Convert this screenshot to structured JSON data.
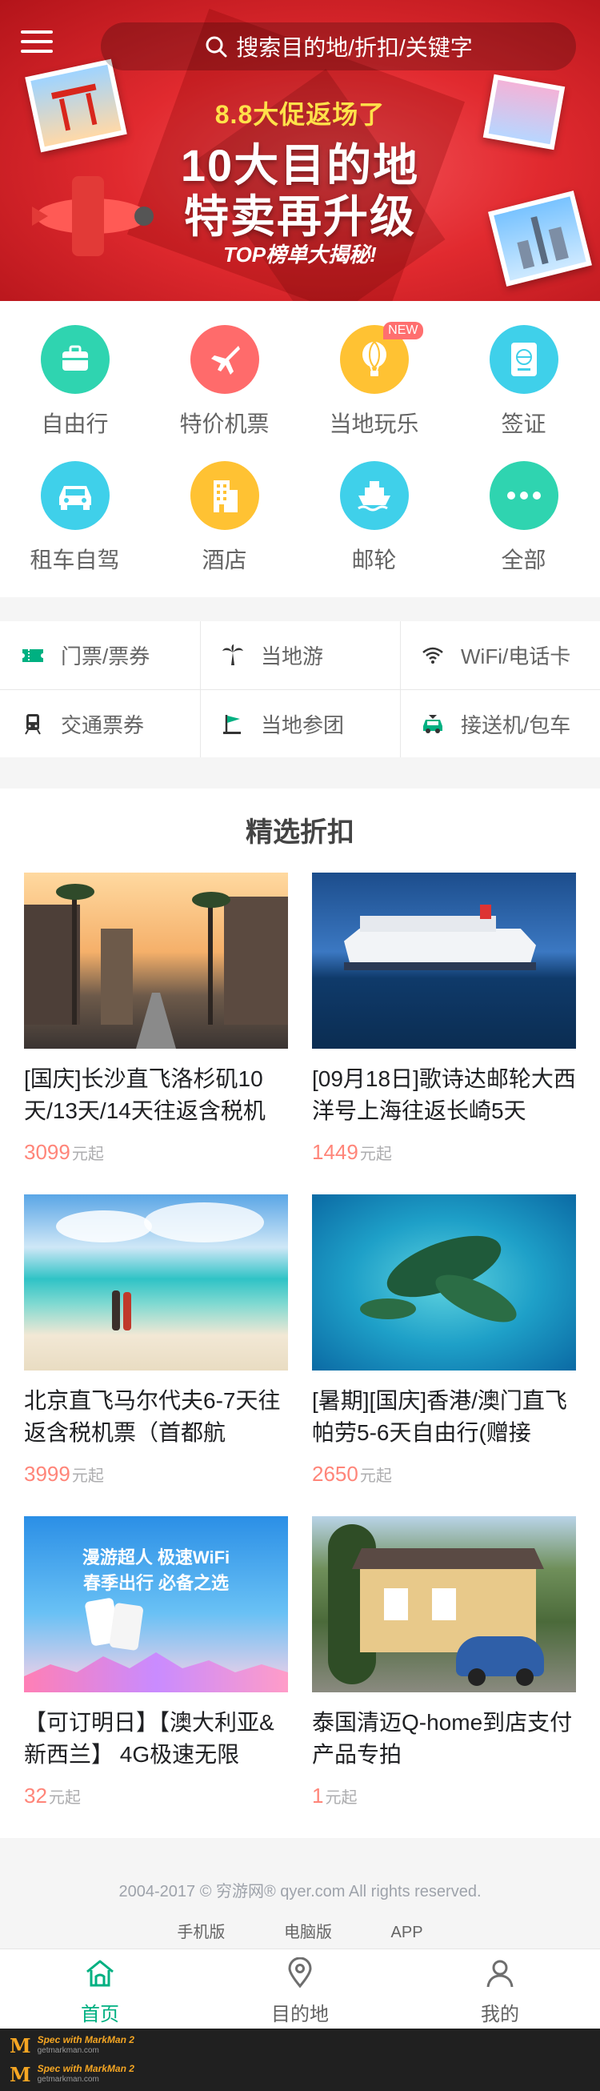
{
  "banner": {
    "search_placeholder": "搜索目的地/折扣/关键字",
    "subtitle": "8.8大促返场了",
    "title_line1": "10大目的地",
    "title_line2": "特卖再升级",
    "tagline": "TOP榜单大揭秘!"
  },
  "categories": [
    {
      "label": "自由行",
      "icon": "suitcase-icon",
      "color": "#2fd4b0"
    },
    {
      "label": "特价机票",
      "icon": "airplane-icon",
      "color": "#ff6b6b"
    },
    {
      "label": "当地玩乐",
      "icon": "balloon-icon",
      "color": "#ffc233",
      "badge": "NEW"
    },
    {
      "label": "签证",
      "icon": "passport-icon",
      "color": "#3fd0ea"
    },
    {
      "label": "租车自驾",
      "icon": "car-icon",
      "color": "#3fd0ea"
    },
    {
      "label": "酒店",
      "icon": "building-icon",
      "color": "#ffc233"
    },
    {
      "label": "邮轮",
      "icon": "ship-icon",
      "color": "#3fd0ea"
    },
    {
      "label": "全部",
      "icon": "more-icon",
      "color": "#2fd4b0"
    }
  ],
  "sub_menu": [
    {
      "label": "门票/票券",
      "icon": "ticket-icon"
    },
    {
      "label": "当地游",
      "icon": "palm-tree-icon"
    },
    {
      "label": "WiFi/电话卡",
      "icon": "wifi-icon"
    },
    {
      "label": "交通票券",
      "icon": "train-icon"
    },
    {
      "label": "当地参团",
      "icon": "flag-icon"
    },
    {
      "label": "接送机/包车",
      "icon": "shuttle-car-icon"
    }
  ],
  "deals_title": "精选折扣",
  "deals": [
    {
      "title": "[国庆]长沙直飞洛杉矶10天/13天/14天往返含税机",
      "price": "3099",
      "unit": "元起",
      "scene": "city-street"
    },
    {
      "title": "[09月18日]歌诗达邮轮大西洋号上海往返长崎5天",
      "price": "1449",
      "unit": "元起",
      "scene": "cruise"
    },
    {
      "title": "北京直飞马尔代夫6-7天往返含税机票（首都航",
      "price": "3999",
      "unit": "元起",
      "scene": "beach"
    },
    {
      "title": "[暑期][国庆]香港/澳门直飞帕劳5-6天自由行(赠接",
      "price": "2650",
      "unit": "元起",
      "scene": "islands"
    },
    {
      "title": "【可订明日】【澳大利亚&新西兰】 4G极速无限",
      "price": "32",
      "unit": "元起",
      "scene": "wifi-ad",
      "ad_line1": "漫游超人 极速WiFi",
      "ad_line2": "春季出行 必备之选"
    },
    {
      "title": "泰国清迈Q-home到店支付产品专拍",
      "price": "1",
      "unit": "元起",
      "scene": "house"
    }
  ],
  "footer": {
    "copyright": "2004-2017 © 穷游网® qyer.com All rights reserved.",
    "links": [
      "手机版",
      "电脑版",
      "APP"
    ]
  },
  "tabs": [
    {
      "label": "首页",
      "icon": "home-icon",
      "active": true
    },
    {
      "label": "目的地",
      "icon": "location-pin-icon",
      "active": false
    },
    {
      "label": "我的",
      "icon": "user-icon",
      "active": false
    }
  ],
  "watermark": {
    "brand": "Spec with MarkMan 2",
    "site": "getmarkman.com"
  },
  "colors": {
    "primary_text": "#1f2023",
    "secondary_text": "#646464",
    "price": "#ff8579",
    "price_unit": "#adadaf",
    "section_bg": "#f5f5f5",
    "tab_active": "#00b081",
    "title": "#444444",
    "footer_text": "#9ea3ab"
  }
}
